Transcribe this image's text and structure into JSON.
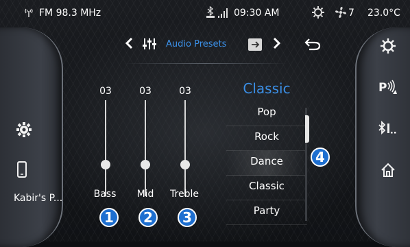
{
  "status_bar": {
    "radio": "FM 98.3 MHz",
    "time": "09:30 AM",
    "fan_speed": "7",
    "temperature": "23.0°C"
  },
  "header": {
    "title": "Audio Presets"
  },
  "equalizer": {
    "sliders": [
      {
        "label": "Bass",
        "value": "03",
        "badge": "1"
      },
      {
        "label": "Mid",
        "value": "03",
        "badge": "2"
      },
      {
        "label": "Treble",
        "value": "03",
        "badge": "3"
      }
    ]
  },
  "presets": {
    "current": "Classic",
    "items": [
      "Pop",
      "Rock",
      "Dance",
      "Classic",
      "Party"
    ],
    "selected_item": "Dance",
    "badge": "4"
  },
  "left_panel": {
    "phone_name": "Kabir's P..."
  },
  "colors": {
    "accent": "#3b8fe6",
    "badge": "#1e6fd0"
  }
}
